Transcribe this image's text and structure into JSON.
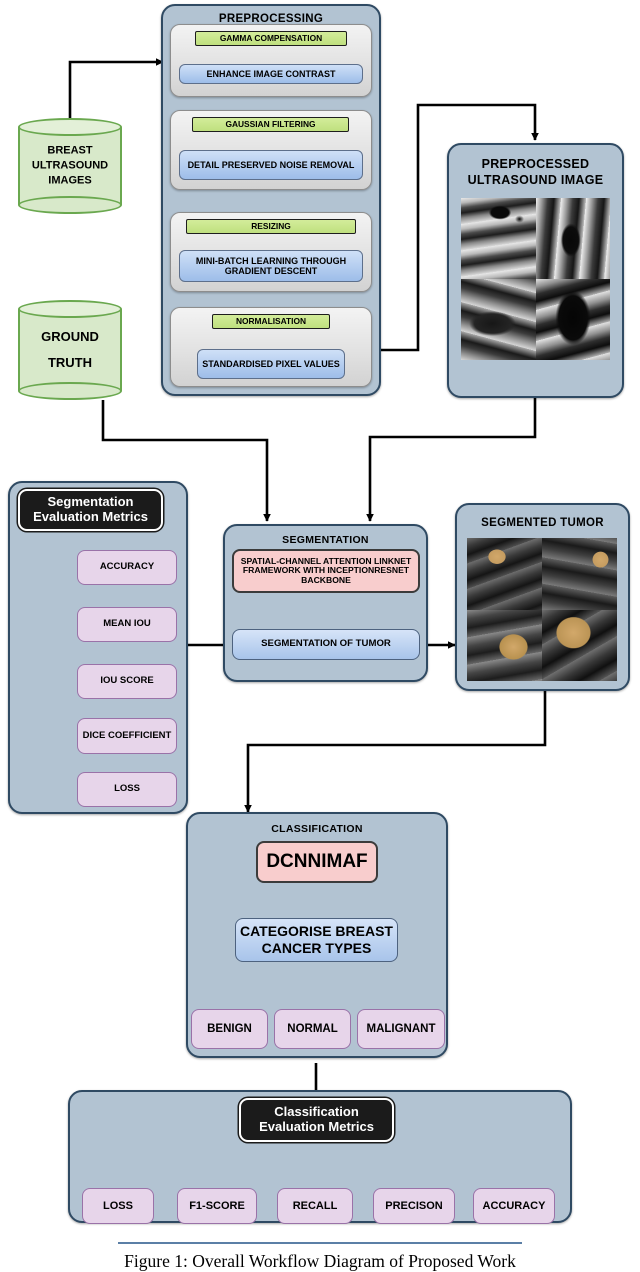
{
  "figure": {
    "caption": "Figure 1: Overall Workflow Diagram of Proposed Work"
  },
  "colors": {
    "panel_fill": "#b2c3d2",
    "panel_border": "#2f4a63",
    "green_box": "#bfe07f",
    "blue_box": "#9dbde9",
    "pink_box": "#f8cdcd",
    "purple_box": "#e7d5ea",
    "black_box": "#1b1b1b",
    "cylinder_fill": "#d8e9ca",
    "cylinder_border": "#6aa84f",
    "arrow": "#000000",
    "tumor_overlay": "#d2a86a"
  },
  "inputs": {
    "breast_ultrasound": "BREAST\nULTRASOUND\nIMAGES",
    "breast_ultrasound_lines": [
      "BREAST",
      "ULTRASOUND",
      "IMAGES"
    ],
    "ground_truth_lines": [
      "GROUND",
      "TRUTH"
    ]
  },
  "preprocessing": {
    "title": "PREPROCESSING",
    "stages": [
      {
        "operation": "GAMMA COMPENSATION",
        "result": "ENHANCE IMAGE CONTRAST"
      },
      {
        "operation": "GAUSSIAN FILTERING",
        "result": "DETAIL PRESERVED NOISE REMOVAL"
      },
      {
        "operation": "RESIZING",
        "result": "MINI-BATCH LEARNING THROUGH GRADIENT DESCENT"
      },
      {
        "operation": "NORMALISATION",
        "result": "STANDARDISED PIXEL VALUES"
      }
    ]
  },
  "preprocessed_image": {
    "title_lines": [
      "PREPROCESSED",
      "ULTRASOUND IMAGE"
    ],
    "tile_count": 4
  },
  "segmentation": {
    "title": "SEGMENTATION",
    "model": "SPATIAL-CHANNEL ATTENTION LINKNET FRAMEWORK WITH INCEPTIONRESNET BACKBONE",
    "output": "SEGMENTATION OF TUMOR"
  },
  "segmented_tumor": {
    "title": "SEGMENTED TUMOR",
    "tile_count": 4
  },
  "segmentation_metrics": {
    "title_lines": [
      "Segmentation",
      "Evaluation Metrics"
    ],
    "items": [
      "ACCURACY",
      "MEAN IOU",
      "IOU SCORE",
      "DICE COEFFICIENT",
      "LOSS"
    ]
  },
  "classification": {
    "title": "CLASSIFICATION",
    "model": "DCNNIMAF",
    "task_lines": [
      "CATEGORISE BREAST",
      "CANCER TYPES"
    ],
    "classes": [
      "BENIGN",
      "NORMAL",
      "MALIGNANT"
    ]
  },
  "classification_metrics": {
    "title_lines": [
      "Classification",
      "Evaluation Metrics"
    ],
    "items": [
      "LOSS",
      "F1-SCORE",
      "RECALL",
      "PRECISON",
      "ACCURACY"
    ]
  }
}
